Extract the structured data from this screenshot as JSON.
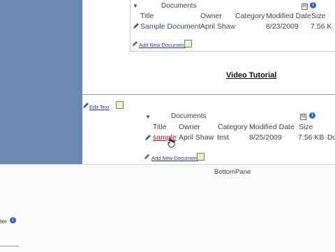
{
  "top_panel": {
    "documents_title": "Documents",
    "columns": [
      "Title",
      "Owner",
      "Category",
      "Modified Date",
      "Size"
    ],
    "row": {
      "title": "Sample Document",
      "owner": "April Shaw",
      "category": "",
      "modified_date": "8/23/2009",
      "size": "7.56 K"
    },
    "add_new_document": "Add New Document"
  },
  "main": {
    "video_tutorial": "Video Tutorial",
    "edit_text": "Edit Text",
    "documents_title": "Documents",
    "columns": [
      "Title",
      "Owner",
      "Category",
      "Modified Date",
      "Size"
    ],
    "row": {
      "title": "sample",
      "owner": "April Shaw",
      "category": "test",
      "modified_date": "8/25/2009",
      "size": "7.56 KB",
      "extra": "Do"
    },
    "add_new_document": "Add New Document"
  },
  "bottom": {
    "pane_label": "BottomPane",
    "edge_text": "ter"
  },
  "icons": {
    "toggle_symbol": "⊟",
    "info_symbol": "i"
  },
  "colors": {
    "sidebar": "#6a88b2",
    "link_blue": "#2b4b8f",
    "red_link": "#c01818"
  }
}
